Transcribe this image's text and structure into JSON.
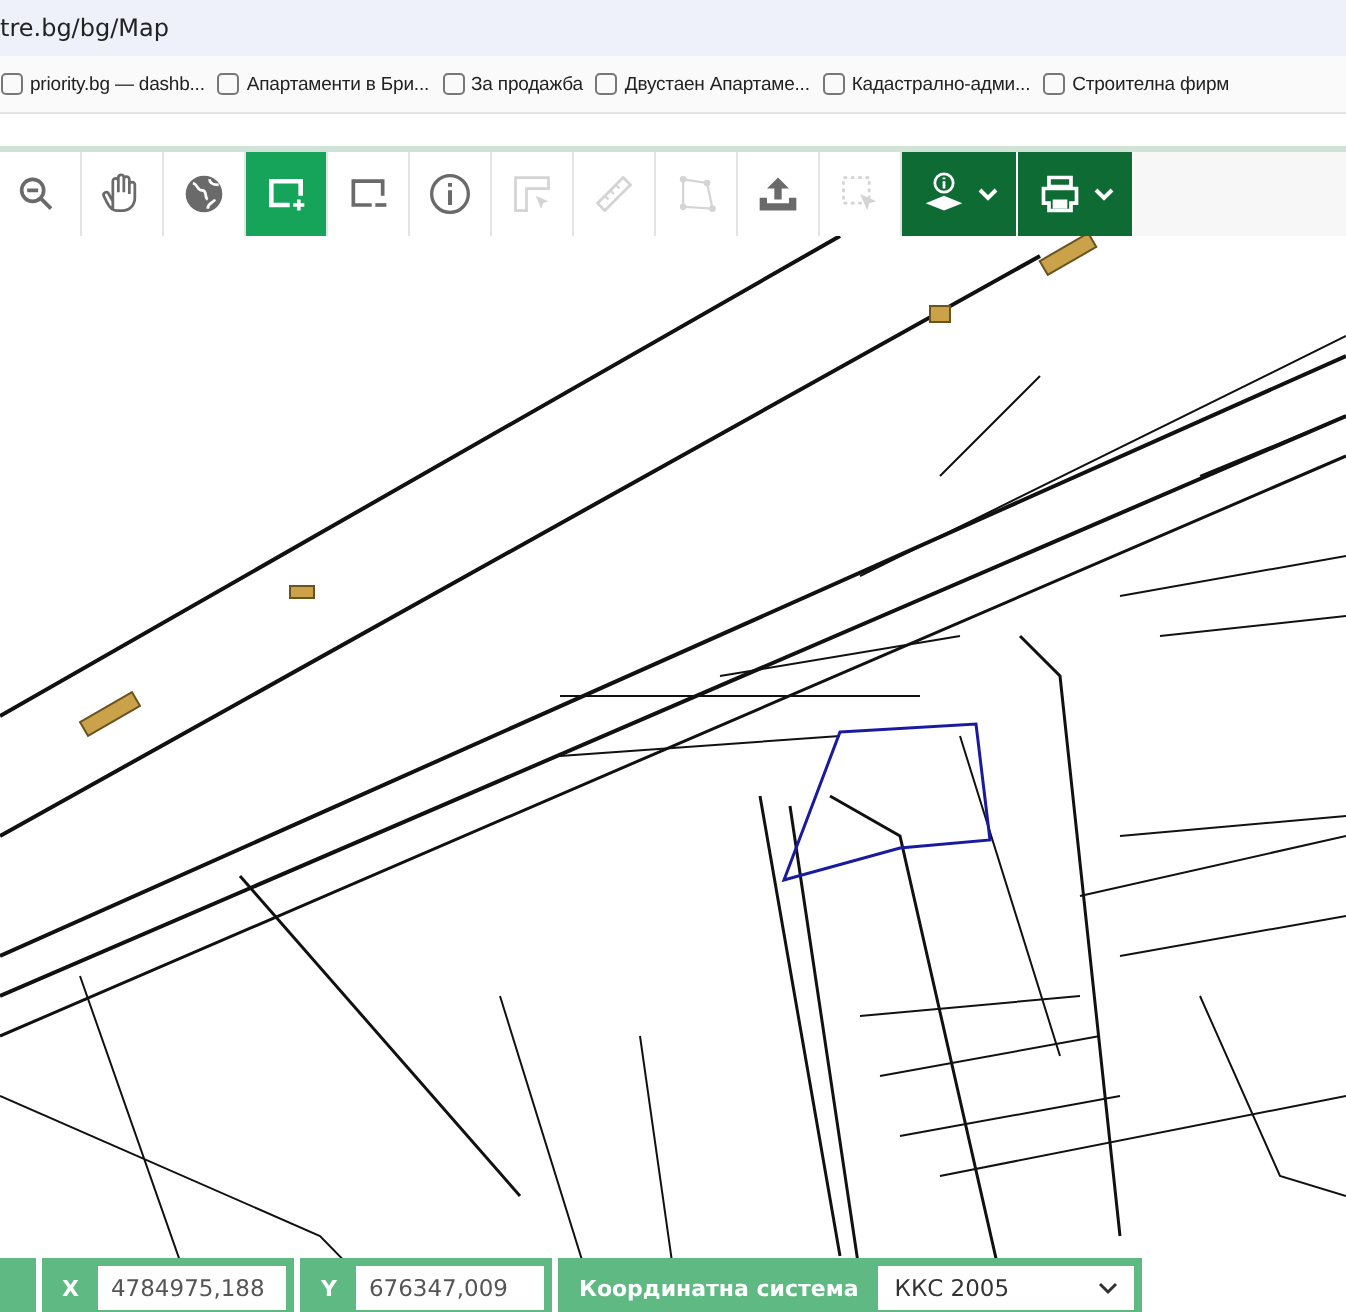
{
  "address_bar": {
    "url": "tre.bg/bg/Map"
  },
  "bookmarks": [
    {
      "label": "priority.bg — dashb..."
    },
    {
      "label": "Апартаменти в Бри..."
    },
    {
      "label": "За продажба"
    },
    {
      "label": "Двустаен Апартаме..."
    },
    {
      "label": "Кадастрално-адми..."
    },
    {
      "label": "Строителна фирм"
    }
  ],
  "toolbar": {
    "tools": [
      {
        "kind": "tool",
        "selected": false,
        "disabled": false
      },
      {
        "kind": "tool",
        "selected": false,
        "disabled": false
      },
      {
        "kind": "tool",
        "selected": false,
        "disabled": false
      },
      {
        "kind": "tool",
        "selected": true,
        "disabled": false
      },
      {
        "kind": "tool",
        "selected": false,
        "disabled": false
      },
      {
        "kind": "tool",
        "selected": false,
        "disabled": false
      },
      {
        "kind": "tool",
        "selected": false,
        "disabled": true
      },
      {
        "kind": "tool",
        "selected": false,
        "disabled": true
      },
      {
        "kind": "tool",
        "selected": false,
        "disabled": true
      },
      {
        "kind": "tool",
        "selected": false,
        "disabled": false
      },
      {
        "kind": "tool",
        "selected": false,
        "disabled": true
      },
      {
        "kind": "dropdown"
      },
      {
        "kind": "dropdown"
      }
    ]
  },
  "coordinates": {
    "x_label": "X",
    "x_value": "4784975,188",
    "y_label": "Y",
    "y_value": "676347,009",
    "system_label": "Координатна система",
    "system_value": "ККС 2005"
  }
}
